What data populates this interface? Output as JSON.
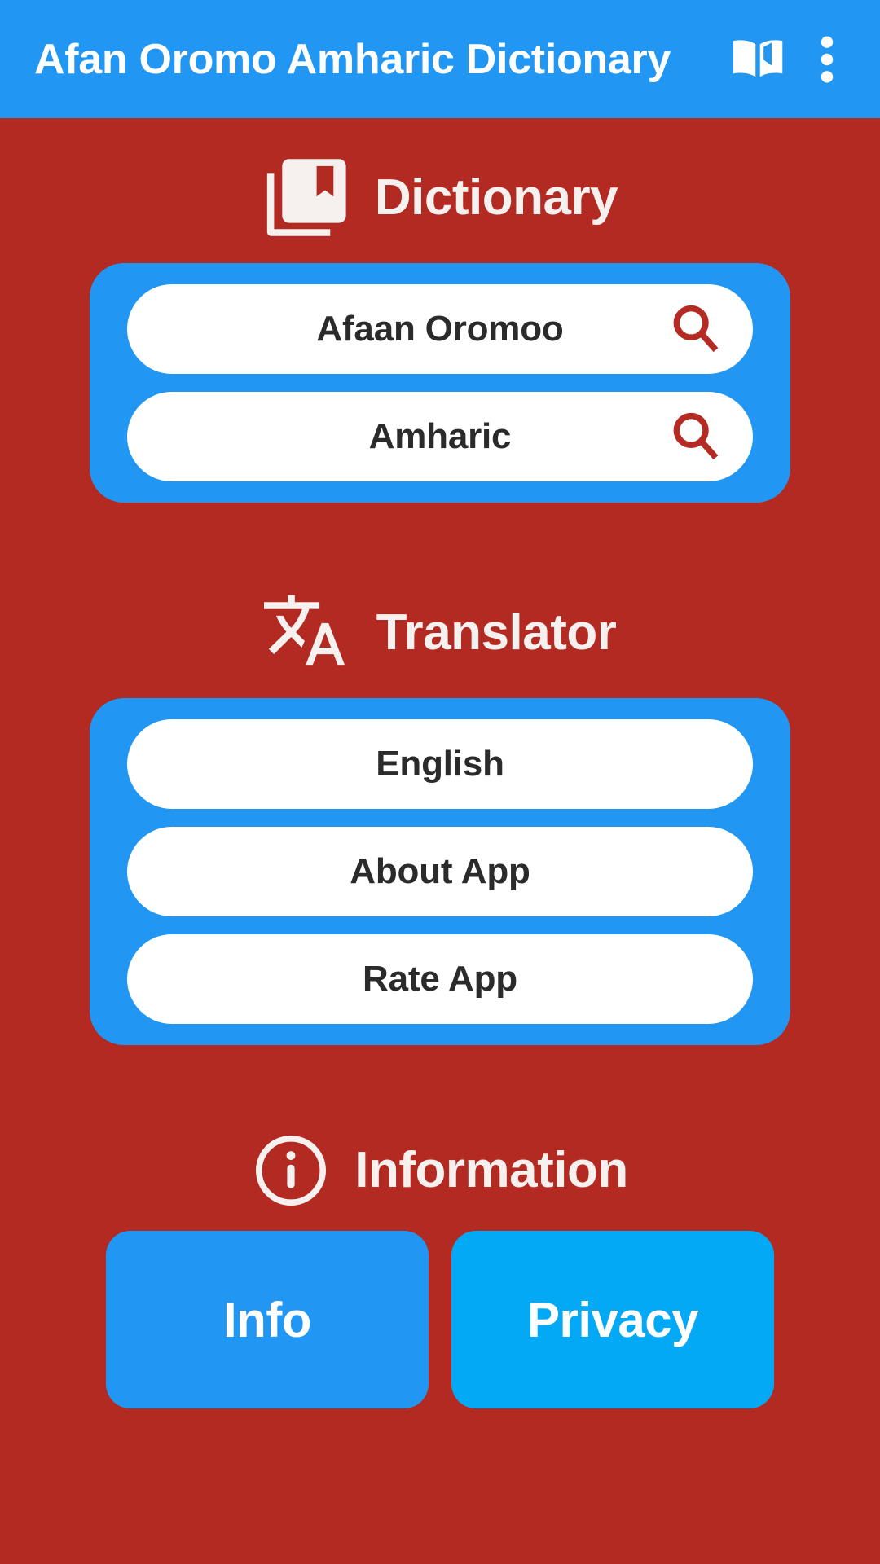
{
  "appbar": {
    "title": "Afan Oromo Amharic Dictionary",
    "book_icon": "open-book-icon",
    "overflow_icon": "more-vert-icon",
    "background_color": "#2196f3",
    "title_color": "#ffffff"
  },
  "theme": {
    "background_color": "#b22a22",
    "card_color": "#2196f3",
    "pill_color": "#ffffff",
    "accent_cyan": "#03a9f4",
    "search_icon_color": "#b32b22",
    "heading_color": "#f6f1ef"
  },
  "sections": [
    {
      "id": "dictionary",
      "title": "Dictionary",
      "icon": "library-books-bookmark-icon",
      "items": [
        {
          "label": "Afaan Oromoo",
          "icon": "search-icon"
        },
        {
          "label": "Amharic",
          "icon": "search-icon"
        }
      ]
    },
    {
      "id": "translator",
      "title": "Translator",
      "icon": "translate-icon",
      "items": [
        {
          "label": "English"
        },
        {
          "label": "About App"
        },
        {
          "label": "Rate App"
        }
      ]
    }
  ],
  "information": {
    "title": "Information",
    "icon": "info-circle-icon",
    "buttons": [
      {
        "label": "Info",
        "color": "#2196f3"
      },
      {
        "label": "Privacy",
        "color": "#03a9f4"
      }
    ]
  }
}
